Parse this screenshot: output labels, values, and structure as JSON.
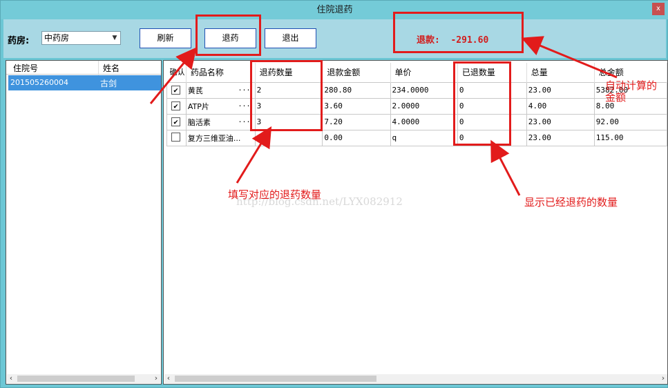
{
  "window": {
    "title": "住院退药",
    "close_label": "x"
  },
  "toolbar": {
    "pharmacy_label": "药房:",
    "pharmacy_value": "中药房",
    "refresh_label": "刷新",
    "return_label": "退药",
    "exit_label": "退出"
  },
  "refund": {
    "label": "退款:",
    "amount": "-291.60"
  },
  "patients": {
    "headers": [
      "住院号",
      "姓名"
    ],
    "rows": [
      {
        "id": "201505260004",
        "name": "古剑"
      }
    ]
  },
  "drugs": {
    "headers": [
      "确认",
      "药品名称",
      "退药数量",
      "退款金额",
      "单价",
      "已退数量",
      "总量",
      "总金额"
    ],
    "rows": [
      {
        "checked": true,
        "name": "黄芪",
        "dots": "...",
        "return_qty": "2",
        "refund_amount": "280.80",
        "unit_price": "234.0000",
        "returned_qty": "0",
        "total_qty": "23.00",
        "total_amount": "5382.00"
      },
      {
        "checked": true,
        "name": "ATP片",
        "dots": "...",
        "return_qty": "3",
        "refund_amount": "3.60",
        "unit_price": "2.0000",
        "returned_qty": "0",
        "total_qty": "4.00",
        "total_amount": "8.00"
      },
      {
        "checked": true,
        "name": "脑活素",
        "dots": "...",
        "return_qty": "3",
        "refund_amount": "7.20",
        "unit_price": "4.0000",
        "returned_qty": "0",
        "total_qty": "23.00",
        "total_amount": "92.00"
      },
      {
        "checked": false,
        "name": "复方三维亚油...",
        "dots": "",
        "return_qty": "",
        "refund_amount": "0.00",
        "unit_price": "q",
        "returned_qty": "0",
        "total_qty": "23.00",
        "total_amount": "115.00"
      }
    ]
  },
  "annotations": {
    "fill_qty": "填写对应的退药数量",
    "show_returned": "显示已经退药的数量",
    "auto_calc_line1": "自动计算的",
    "auto_calc_line2": "金额",
    "watermark": "http://blog.csdn.net/LYX082912"
  },
  "colors": {
    "annotation_red": "#e21b1b",
    "selection_blue": "#3f93de",
    "window_teal": "#6cc7d5"
  }
}
